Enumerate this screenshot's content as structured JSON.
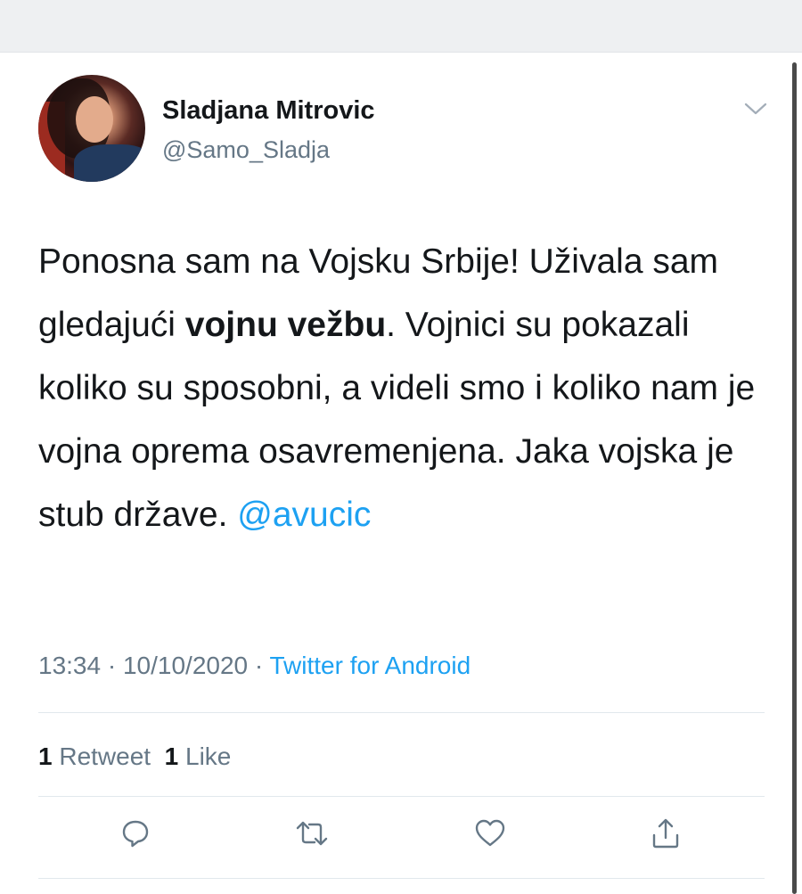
{
  "tweet": {
    "author": {
      "name": "Sladjana Mitrovic",
      "handle": "@Samo_Sladja"
    },
    "text": {
      "part1": "Ponosna sam na Vojsku Srbije! Uživala sam gledajući ",
      "bold": "vojnu vežbu",
      "part2": ". Vojnici su pokazali koliko su sposobni, a videli smo i koliko nam je vojna oprema osavremenjena. Jaka vojska je stub države. ",
      "mention": "@avucic"
    },
    "meta": {
      "time": "13:34",
      "separator1": " · ",
      "date": "10/10/2020",
      "separator2": " · ",
      "source": "Twitter for Android"
    },
    "stats": {
      "retweets_count": "1",
      "retweets_label": "Retweet",
      "likes_count": "1",
      "likes_label": "Like"
    },
    "actions": [
      {
        "icon": "reply-icon"
      },
      {
        "icon": "retweet-icon"
      },
      {
        "icon": "like-icon"
      },
      {
        "icon": "share-icon"
      }
    ]
  },
  "colors": {
    "link": "#1da1f2",
    "secondary_text": "#657786",
    "primary_text": "#14171a",
    "divider": "#e1e8ed"
  }
}
